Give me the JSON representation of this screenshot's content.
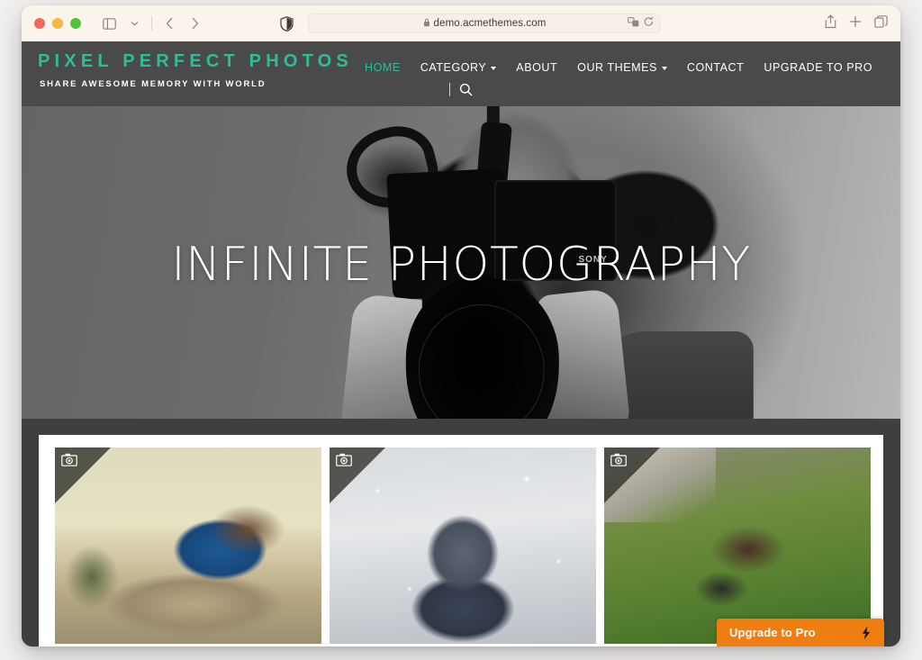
{
  "browser": {
    "url": "demo.acmethemes.com",
    "lock_icon": "lock-icon",
    "shield_icon": "privacy-shield-icon",
    "sidebar_icon": "sidebar-toggle-icon",
    "tabgroup_icon": "tab-group-chevron-icon",
    "back_icon": "back-arrow-icon",
    "forward_icon": "forward-arrow-icon",
    "reader_icon": "page-settings-icon",
    "reload_icon": "reload-icon",
    "share_icon": "share-icon",
    "newtab_icon": "new-tab-icon",
    "tabs_icon": "tab-overview-icon",
    "traffic_lights": [
      "close",
      "minimize",
      "zoom"
    ]
  },
  "site": {
    "title": "PIXEL PERFECT PHOTOS",
    "tagline": "SHARE AWESOME MEMORY WITH WORLD",
    "accent_color": "#2ebd9a",
    "header_bg": "#4a4a4a",
    "page_bg": "#3f3f3f",
    "nav": [
      {
        "label": "HOME",
        "active": true,
        "has_dropdown": false
      },
      {
        "label": "CATEGORY",
        "active": false,
        "has_dropdown": true
      },
      {
        "label": "ABOUT",
        "active": false,
        "has_dropdown": false
      },
      {
        "label": "OUR THEMES",
        "active": false,
        "has_dropdown": true
      },
      {
        "label": "CONTACT",
        "active": false,
        "has_dropdown": false
      },
      {
        "label": "UPGRADE TO PRO",
        "active": false,
        "has_dropdown": false
      }
    ],
    "search": {
      "icon": "search-icon"
    },
    "hero": {
      "title": "INFINITE PHOTOGRAPHY",
      "image_alt": "Black and white photo of a person holding a Sony camera",
      "camera_brand": "SONY"
    },
    "gallery": {
      "ribbon_icon": "camera-icon",
      "cards": [
        {
          "alt": "Woman in blue dress lying on rocks"
        },
        {
          "alt": "Woman in fur hood blowing snow"
        },
        {
          "alt": "Woman lying upside down in green grass"
        }
      ]
    },
    "upgrade": {
      "label": "Upgrade to Pro",
      "icon": "lightning-bolt-icon",
      "bg_color": "#f07d10"
    }
  }
}
